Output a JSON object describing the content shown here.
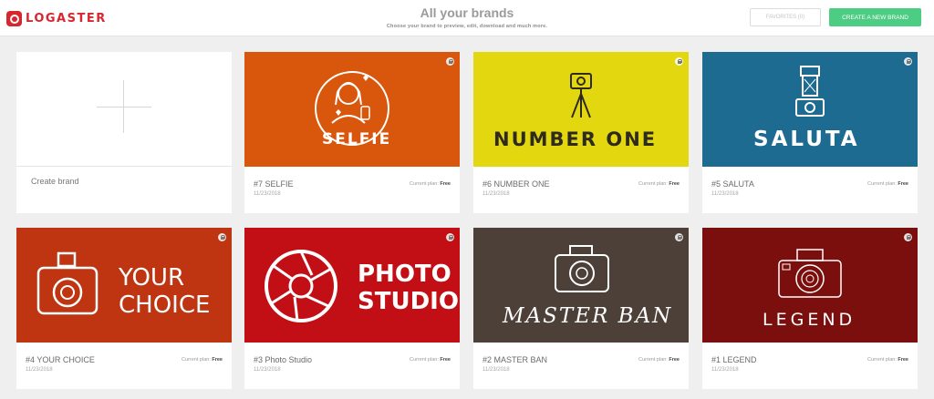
{
  "header": {
    "logo_text": "LOGASTER",
    "title": "All your brands",
    "subtitle": "Choose your brand to preview, edit, download and much more.",
    "favorites_label": "FAVORITES (0)",
    "create_label": "CREATE A NEW BRAND"
  },
  "create_card": {
    "label": "Create brand"
  },
  "plan_prefix": "Current plan:",
  "brands": [
    {
      "title": "#7 SELFIE",
      "logo_text": "SELFIE",
      "date": "11/23/2018",
      "plan": "Free",
      "color": "#d8570c",
      "icon": "selfie-woman-icon"
    },
    {
      "title": "#6 NUMBER ONE",
      "logo_text": "NUMBER ONE",
      "date": "11/23/2018",
      "plan": "Free",
      "color": "#e3d810",
      "icon": "camera-tripod-icon"
    },
    {
      "title": "#5 SALUTA",
      "logo_text": "SALUTA",
      "date": "11/23/2018",
      "plan": "Free",
      "color": "#1e6b91",
      "icon": "lamp-camera-icon"
    },
    {
      "title": "#4 YOUR CHOICE",
      "logo_text_line1": "YOUR",
      "logo_text_line2": "CHOICE",
      "date": "11/23/2018",
      "plan": "Free",
      "color": "#bf3512",
      "icon": "camera-icon"
    },
    {
      "title": "#3 Photo Studio",
      "logo_text_line1": "PHOTO",
      "logo_text_line2": "STUDIO",
      "date": "11/23/2018",
      "plan": "Free",
      "color": "#c20e15",
      "icon": "aperture-icon"
    },
    {
      "title": "#2 MASTER BAN",
      "logo_text": "MASTER BAN",
      "date": "11/23/2018",
      "plan": "Free",
      "color": "#4c4038",
      "icon": "camera-icon"
    },
    {
      "title": "#1 LEGEND",
      "logo_text": "LEGEND",
      "date": "11/23/2018",
      "plan": "Free",
      "color": "#7a0f0e",
      "icon": "dslr-camera-icon"
    }
  ]
}
